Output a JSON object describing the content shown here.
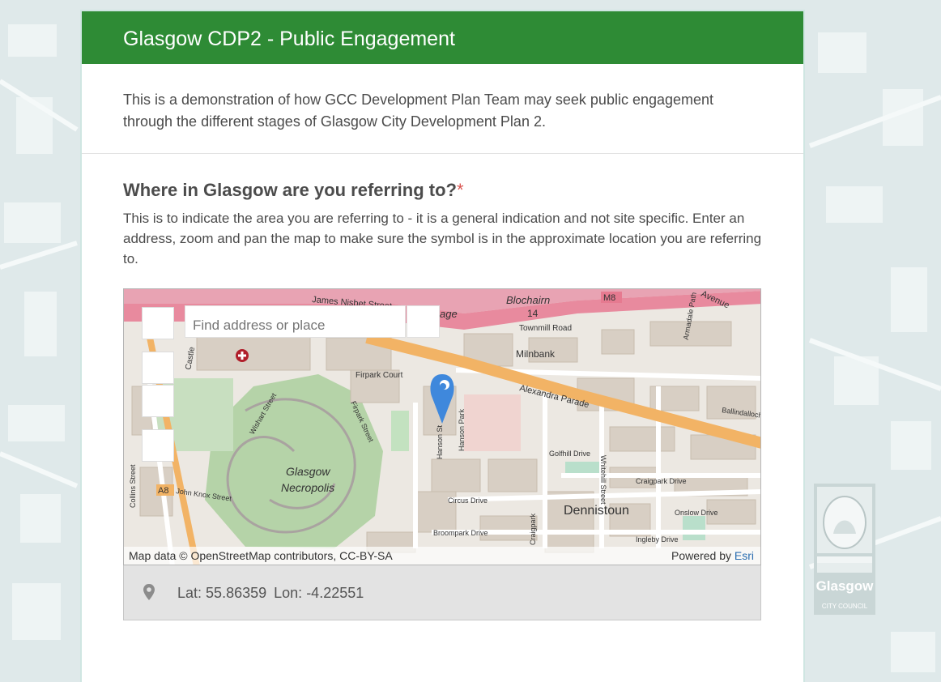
{
  "header": {
    "title": "Glasgow CDP2 - Public Engagement"
  },
  "intro": {
    "text": "This is a demonstration of how GCC Development Plan Team may seek public engagement through the different stages of Glasgow City Development Plan 2."
  },
  "question": {
    "title": "Where in Glasgow are you referring to?",
    "required_marker": "*",
    "description": "This is to indicate the area you are referring to - it is a general indication and not site specific. Enter an address, zoom and pan the map to make sure the symbol is in the approximate location you are referring to."
  },
  "map": {
    "search_placeholder": "Find address or place",
    "attribution": "Map data © OpenStreetMap contributors, CC-BY-SA",
    "powered_by": "Powered by",
    "powered_by_link": "Esri",
    "labels": {
      "james_nisbet": "James Nisbet Street",
      "blochairn": "Blochairn",
      "m8": "M8",
      "fourteen": "14",
      "avenue": "Avenue",
      "townmill": "Townmill Road",
      "milnbank": "Milnbank",
      "firpark_court": "Firpark Court",
      "alexandra": "Alexandra Parade",
      "firpark_street": "Firpark Street",
      "wishart": "Wishart Street",
      "hanson_park": "Hanson Park",
      "hanson_st": "Hanson St",
      "golfhill": "Golfhill Drive",
      "whitehill": "Whitehill Street",
      "craigpark_drive": "Craigpark Drive",
      "dennistoun": "Dennistoun",
      "onslow": "Onslow Drive",
      "circus": "Circus Drive",
      "broompark": "Broompark Drive",
      "craigpark": "Craigpark",
      "ingleby": "Ingleby Drive",
      "glasgow": "Glasgow",
      "necropolis": "Necropolis",
      "a8": "A8",
      "john_knox": "John Knox Street",
      "collins": "Collins Street",
      "armadale": "Armadale Path",
      "ballindalloch": "Ballindalloch",
      "gage": "age",
      "castle": "Castle"
    }
  },
  "location": {
    "lat_label": "Lat:",
    "lat": "55.86359",
    "lon_label": "Lon:",
    "lon": "-4.22551"
  },
  "logo": {
    "name": "Glasgow",
    "sub": "CITY COUNCIL"
  },
  "colors": {
    "header_bg": "#2e8b35",
    "marker": "#3f88dc",
    "required": "#d9534f"
  }
}
